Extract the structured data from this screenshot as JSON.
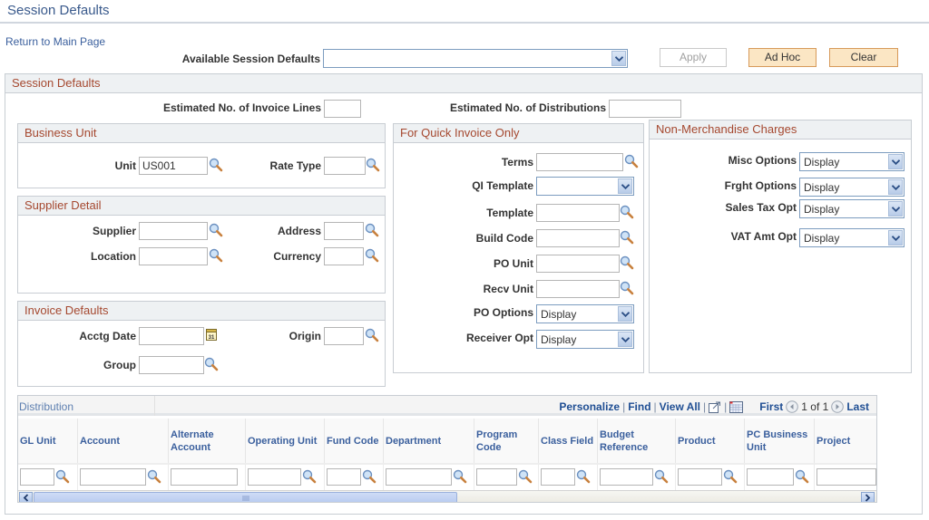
{
  "page": {
    "title": "Session Defaults",
    "return_link": "Return to Main Page"
  },
  "toolbar": {
    "available_label": "Available Session Defaults",
    "available_value": "",
    "apply_label": "Apply",
    "adhoc_label": "Ad Hoc",
    "clear_label": "Clear"
  },
  "session": {
    "header": "Session Defaults",
    "est_lines_label": "Estimated No. of Invoice Lines",
    "est_lines_value": "",
    "est_dist_label": "Estimated No. of Distributions",
    "est_dist_value": ""
  },
  "business_unit": {
    "header": "Business Unit",
    "unit_label": "Unit",
    "unit_value": "US001",
    "rate_type_label": "Rate Type",
    "rate_type_value": ""
  },
  "supplier_detail": {
    "header": "Supplier Detail",
    "supplier_label": "Supplier",
    "address_label": "Address",
    "location_label": "Location",
    "currency_label": "Currency"
  },
  "invoice_defaults": {
    "header": "Invoice Defaults",
    "acctg_date_label": "Acctg Date",
    "origin_label": "Origin",
    "group_label": "Group"
  },
  "quick_invoice": {
    "header": "For Quick Invoice Only",
    "terms_label": "Terms",
    "qi_template_label": "QI Template",
    "qi_template_value": "",
    "template_label": "Template",
    "build_code_label": "Build Code",
    "po_unit_label": "PO Unit",
    "recv_unit_label": "Recv Unit",
    "po_options_label": "PO Options",
    "po_options_value": "Display",
    "receiver_opt_label": "Receiver Opt",
    "receiver_opt_value": "Display"
  },
  "non_merch": {
    "header": "Non-Merchandise Charges",
    "misc_label": "Misc Options",
    "misc_value": "Display",
    "frght_label": "Frght Options",
    "frght_value": "Display",
    "sales_tax_label": "Sales Tax Opt",
    "sales_tax_value": "Display",
    "vat_label": "VAT Amt Opt",
    "vat_value": "Display"
  },
  "distribution": {
    "title": "Distribution",
    "nav": {
      "personalize": "Personalize",
      "find": "Find",
      "view_all": "View All",
      "separator": "|",
      "first": "First",
      "page_info": "1 of 1",
      "last": "Last"
    },
    "columns": [
      {
        "label": "GL Unit",
        "lookup": true
      },
      {
        "label": "Account",
        "lookup": true
      },
      {
        "label": "Alternate Account",
        "lookup": false
      },
      {
        "label": "Operating Unit",
        "lookup": true
      },
      {
        "label": "Fund Code",
        "lookup": true
      },
      {
        "label": "Department",
        "lookup": true
      },
      {
        "label": "Program Code",
        "lookup": true
      },
      {
        "label": "Class Field",
        "lookup": true
      },
      {
        "label": "Budget Reference",
        "lookup": true
      },
      {
        "label": "Product",
        "lookup": true
      },
      {
        "label": "PC Business Unit",
        "lookup": true
      },
      {
        "label": "Project",
        "lookup": false
      }
    ]
  }
}
